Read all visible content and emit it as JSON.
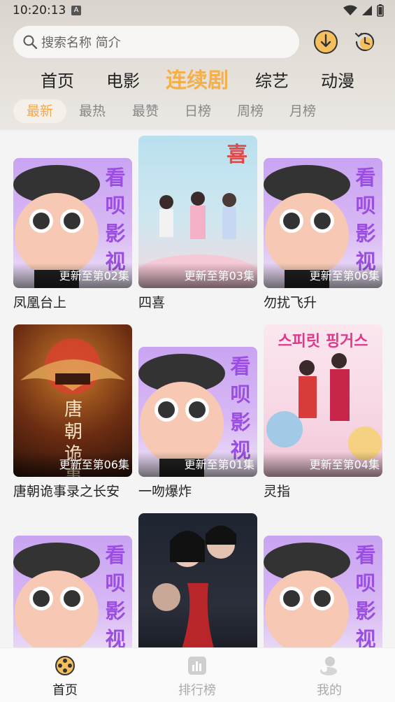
{
  "status_bar": {
    "time": "10:20:13",
    "indicator": "A"
  },
  "search": {
    "placeholder": "搜索名称 简介",
    "icon": "search-icon"
  },
  "header_buttons": [
    {
      "name": "download-icon"
    },
    {
      "name": "history-icon"
    }
  ],
  "categories": [
    {
      "label": "首页",
      "active": false
    },
    {
      "label": "电影",
      "active": false
    },
    {
      "label": "连续剧",
      "active": true
    },
    {
      "label": "综艺",
      "active": false
    },
    {
      "label": "动漫",
      "active": false
    }
  ],
  "sort_tabs": [
    {
      "label": "最新",
      "active": true
    },
    {
      "label": "最热",
      "active": false
    },
    {
      "label": "最赞",
      "active": false
    },
    {
      "label": "日榜",
      "active": false
    },
    {
      "label": "周榜",
      "active": false
    },
    {
      "label": "月榜",
      "active": false
    }
  ],
  "placeholder_text": "看呗影视",
  "items": [
    {
      "title": "凤凰台上",
      "badge": "更新至第02集",
      "poster": "placeholder"
    },
    {
      "title": "四喜",
      "badge": "更新至第03集",
      "poster": "sixi"
    },
    {
      "title": "勿扰飞升",
      "badge": "更新至第06集",
      "poster": "placeholder"
    },
    {
      "title": "唐朝诡事录之长安",
      "badge": "更新至第06集",
      "poster": "tang"
    },
    {
      "title": "一吻爆炸",
      "badge": "更新至第01集",
      "poster": "placeholder"
    },
    {
      "title": "灵指",
      "badge": "更新至第04集",
      "poster": "korean"
    },
    {
      "title": "",
      "badge": "",
      "poster": "placeholder"
    },
    {
      "title": "",
      "badge": "",
      "poster": "dark"
    },
    {
      "title": "",
      "badge": "",
      "poster": "placeholder"
    }
  ],
  "poster_text": {
    "sixi_char": "喜",
    "tang_title": "唐朝\n诡事",
    "korean_title": "스피릿 핑거스"
  },
  "bottom_nav": [
    {
      "label": "首页",
      "icon": "film-reel-icon",
      "active": true
    },
    {
      "label": "排行榜",
      "icon": "ranking-chart-icon",
      "active": false
    },
    {
      "label": "我的",
      "icon": "profile-icon",
      "active": false
    }
  ],
  "colors": {
    "accent": "#f5b04c",
    "placeholder_purple": "#9b4fe0"
  }
}
